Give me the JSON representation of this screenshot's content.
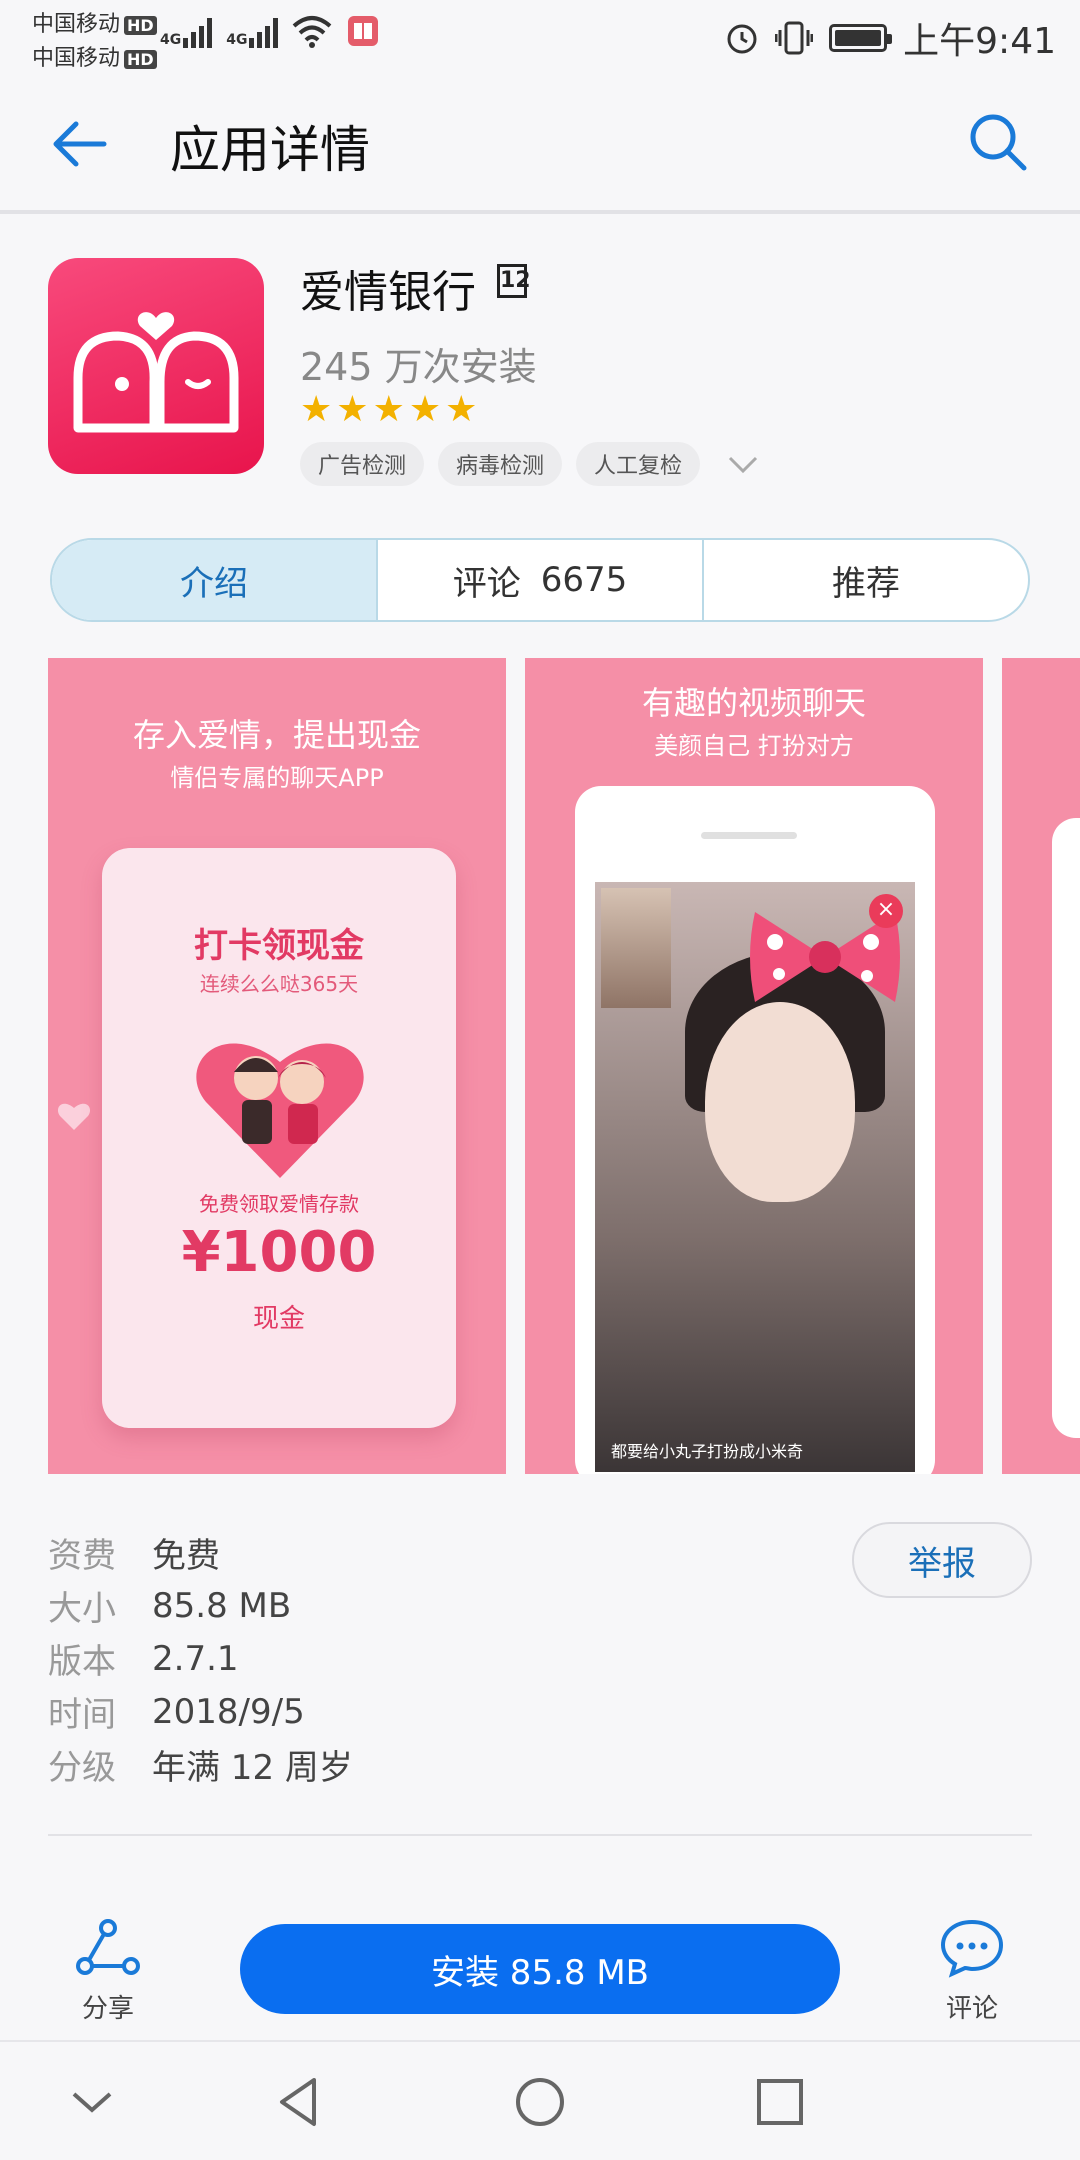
{
  "status_bar": {
    "carrier1": "中国移动",
    "carrier2": "中国移动",
    "hd": "HD",
    "net1": "4G",
    "net2": "4G",
    "time": "上午9:41"
  },
  "app_bar": {
    "title": "应用详情"
  },
  "app": {
    "name": "爱情银行",
    "age_badge": "12",
    "installs": "245 万次安装",
    "rating": 5,
    "chips": [
      "广告检测",
      "病毒检测",
      "人工复检"
    ]
  },
  "tabs": [
    {
      "label": "介绍",
      "count": ""
    },
    {
      "label": "评论",
      "count": "6675"
    },
    {
      "label": "推荐",
      "count": ""
    }
  ],
  "screenshots": {
    "s1": {
      "title": "存入爱情，提出现金",
      "subtitle": "情侣专属的聊天APP",
      "phone_title": "打卡领现金",
      "phone_sub": "连续么么哒365天",
      "claim": "免费领取爱情存款",
      "amount": "¥1000",
      "cash": "现金"
    },
    "s2": {
      "title": "有趣的视频聊天",
      "subtitle": "美颜自己 打扮对方",
      "caption": "都要给小丸子打扮成小米奇"
    }
  },
  "info": {
    "rows": [
      {
        "key": "资费",
        "value": "免费"
      },
      {
        "key": "大小",
        "value": "85.8 MB"
      },
      {
        "key": "版本",
        "value": "2.7.1"
      },
      {
        "key": "时间",
        "value": "2018/9/5"
      },
      {
        "key": "分级",
        "value": "年满 12 周岁"
      }
    ],
    "report_label": "举报"
  },
  "actions": {
    "share_label": "分享",
    "install_label": "安装 85.8 MB",
    "comment_label": "评论"
  },
  "colors": {
    "accent": "#0a6ef0",
    "tab_active": "#1a6fb8",
    "star": "#f3b100",
    "app_icon": "#f0265a",
    "screenshot_bg": "#f58fa7"
  }
}
